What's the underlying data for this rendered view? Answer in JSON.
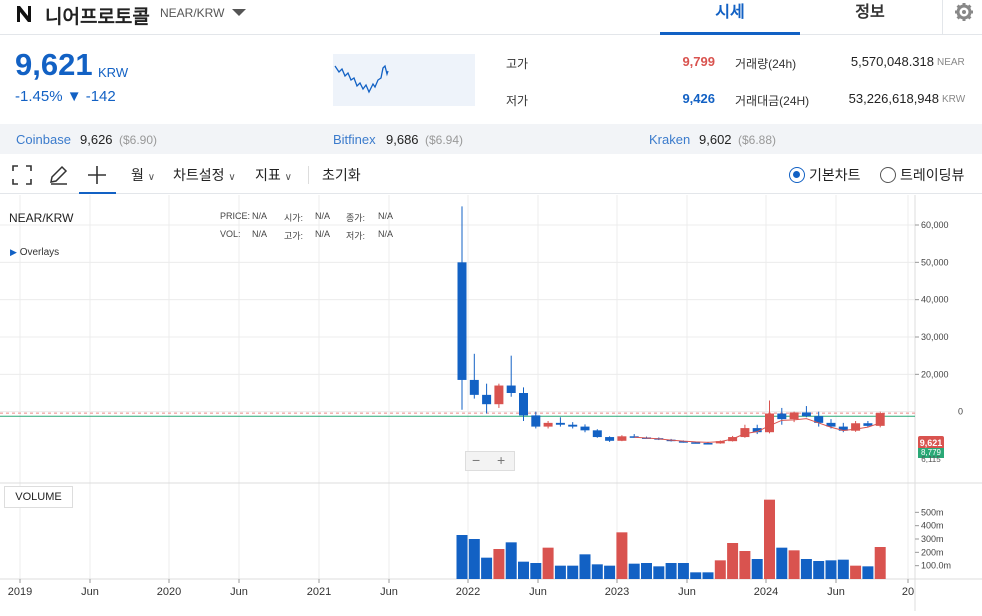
{
  "header": {
    "coin_name": "니어프로토콜",
    "pair": "NEAR/KRW",
    "tabs": [
      "시세",
      "정보"
    ]
  },
  "price": {
    "current": "9,621",
    "unit": "KRW",
    "change_pct": "-1.45%",
    "change_abs": "▼ -142"
  },
  "stats": {
    "high_label": "고가",
    "high": "9,799",
    "low_label": "저가",
    "low": "9,426",
    "volume_label": "거래량(24h)",
    "volume": "5,570,048.318",
    "volume_unit": "NEAR",
    "turnover_label": "거래대금(24H)",
    "turnover": "53,226,618,948",
    "turnover_unit": "KRW"
  },
  "exchanges": [
    {
      "name": "Coinbase",
      "price": "9,626",
      "usd": "($6.90)"
    },
    {
      "name": "Bitfinex",
      "price": "9,686",
      "usd": "($6.94)"
    },
    {
      "name": "Kraken",
      "price": "9,602",
      "usd": "($6.88)"
    }
  ],
  "toolbar": {
    "period": "월",
    "chart_settings": "차트설정",
    "indicators": "지표",
    "reset": "초기화",
    "basic_chart": "기본차트",
    "tradingview": "트레이딩뷰"
  },
  "chart_header": {
    "symbol": "NEAR/KRW",
    "overlays": "Overlays",
    "price_lbl": "PRICE:",
    "open_lbl": "시가:",
    "close_lbl": "종가:",
    "vol_lbl": "VOL:",
    "high_lbl": "고가:",
    "low_lbl": "저가:",
    "na": "N/A",
    "volume_panel": "VOLUME",
    "last_price_tag": "9,621",
    "ma_tag1": "8,779",
    "ma_tag2": "6,115"
  },
  "colors": {
    "up": "#d9534f",
    "down": "#1261c4",
    "accent": "#1261c4"
  },
  "chart_data": {
    "type": "candlestick",
    "price_ticks": [
      "60,000",
      "50,000",
      "40,000",
      "30,000",
      "20,000",
      "0"
    ],
    "volume_ticks": [
      "500m",
      "400m",
      "300m",
      "200m",
      "100.0m"
    ],
    "x_labels": [
      "2019",
      "Jun",
      "2020",
      "Jun",
      "2021",
      "Jun",
      "2022",
      "Jun",
      "2023",
      "Jun",
      "2024",
      "Jun",
      "20"
    ],
    "candles": [
      {
        "o": 50000,
        "h": 65000,
        "l": 10500,
        "c": 18500
      },
      {
        "o": 18500,
        "h": 25500,
        "l": 13500,
        "c": 14500
      },
      {
        "o": 14500,
        "h": 17500,
        "l": 9500,
        "c": 12000
      },
      {
        "o": 12000,
        "h": 17500,
        "l": 11000,
        "c": 17000
      },
      {
        "o": 17000,
        "h": 25000,
        "l": 14000,
        "c": 15000
      },
      {
        "o": 15000,
        "h": 16500,
        "l": 7500,
        "c": 9000
      },
      {
        "o": 9000,
        "h": 10000,
        "l": 5500,
        "c": 6000
      },
      {
        "o": 6000,
        "h": 7500,
        "l": 5500,
        "c": 7000
      },
      {
        "o": 7000,
        "h": 8500,
        "l": 6000,
        "c": 6500
      },
      {
        "o": 6500,
        "h": 7200,
        "l": 5500,
        "c": 6000
      },
      {
        "o": 6000,
        "h": 6600,
        "l": 4500,
        "c": 5000
      },
      {
        "o": 5000,
        "h": 5300,
        "l": 3000,
        "c": 3200
      },
      {
        "o": 3200,
        "h": 3400,
        "l": 1900,
        "c": 2200
      },
      {
        "o": 2200,
        "h": 3700,
        "l": 2100,
        "c": 3400
      },
      {
        "o": 3400,
        "h": 4000,
        "l": 3000,
        "c": 3100
      },
      {
        "o": 3100,
        "h": 3300,
        "l": 2800,
        "c": 2900
      },
      {
        "o": 2900,
        "h": 3100,
        "l": 2400,
        "c": 2500
      },
      {
        "o": 2500,
        "h": 2700,
        "l": 2000,
        "c": 2100
      },
      {
        "o": 2100,
        "h": 2300,
        "l": 1700,
        "c": 1800
      },
      {
        "o": 1800,
        "h": 2000,
        "l": 1500,
        "c": 1600
      },
      {
        "o": 1600,
        "h": 1900,
        "l": 1300,
        "c": 1500
      },
      {
        "o": 1500,
        "h": 2300,
        "l": 1400,
        "c": 2100
      },
      {
        "o": 2100,
        "h": 3500,
        "l": 2000,
        "c": 3200
      },
      {
        "o": 3200,
        "h": 6500,
        "l": 3000,
        "c": 5600
      },
      {
        "o": 5600,
        "h": 6500,
        "l": 4000,
        "c": 4500
      },
      {
        "o": 4500,
        "h": 13000,
        "l": 4200,
        "c": 9500
      },
      {
        "o": 9500,
        "h": 11000,
        "l": 6500,
        "c": 8000
      },
      {
        "o": 8000,
        "h": 10000,
        "l": 7200,
        "c": 9800
      },
      {
        "o": 9800,
        "h": 11500,
        "l": 8500,
        "c": 8800
      },
      {
        "o": 8800,
        "h": 10000,
        "l": 6000,
        "c": 7000
      },
      {
        "o": 7000,
        "h": 8000,
        "l": 5500,
        "c": 6000
      },
      {
        "o": 6000,
        "h": 7000,
        "l": 4500,
        "c": 4900
      },
      {
        "o": 4900,
        "h": 7500,
        "l": 4600,
        "c": 6900
      },
      {
        "o": 6900,
        "h": 7500,
        "l": 5800,
        "c": 6200
      },
      {
        "o": 6200,
        "h": 10000,
        "l": 5800,
        "c": 9621
      }
    ],
    "volumes": [
      330,
      300,
      160,
      225,
      275,
      130,
      120,
      235,
      100,
      100,
      185,
      110,
      100,
      350,
      115,
      120,
      95,
      120,
      120,
      50,
      50,
      140,
      270,
      210,
      150,
      595,
      235,
      215,
      150,
      135,
      140,
      145,
      100,
      95,
      240
    ]
  }
}
